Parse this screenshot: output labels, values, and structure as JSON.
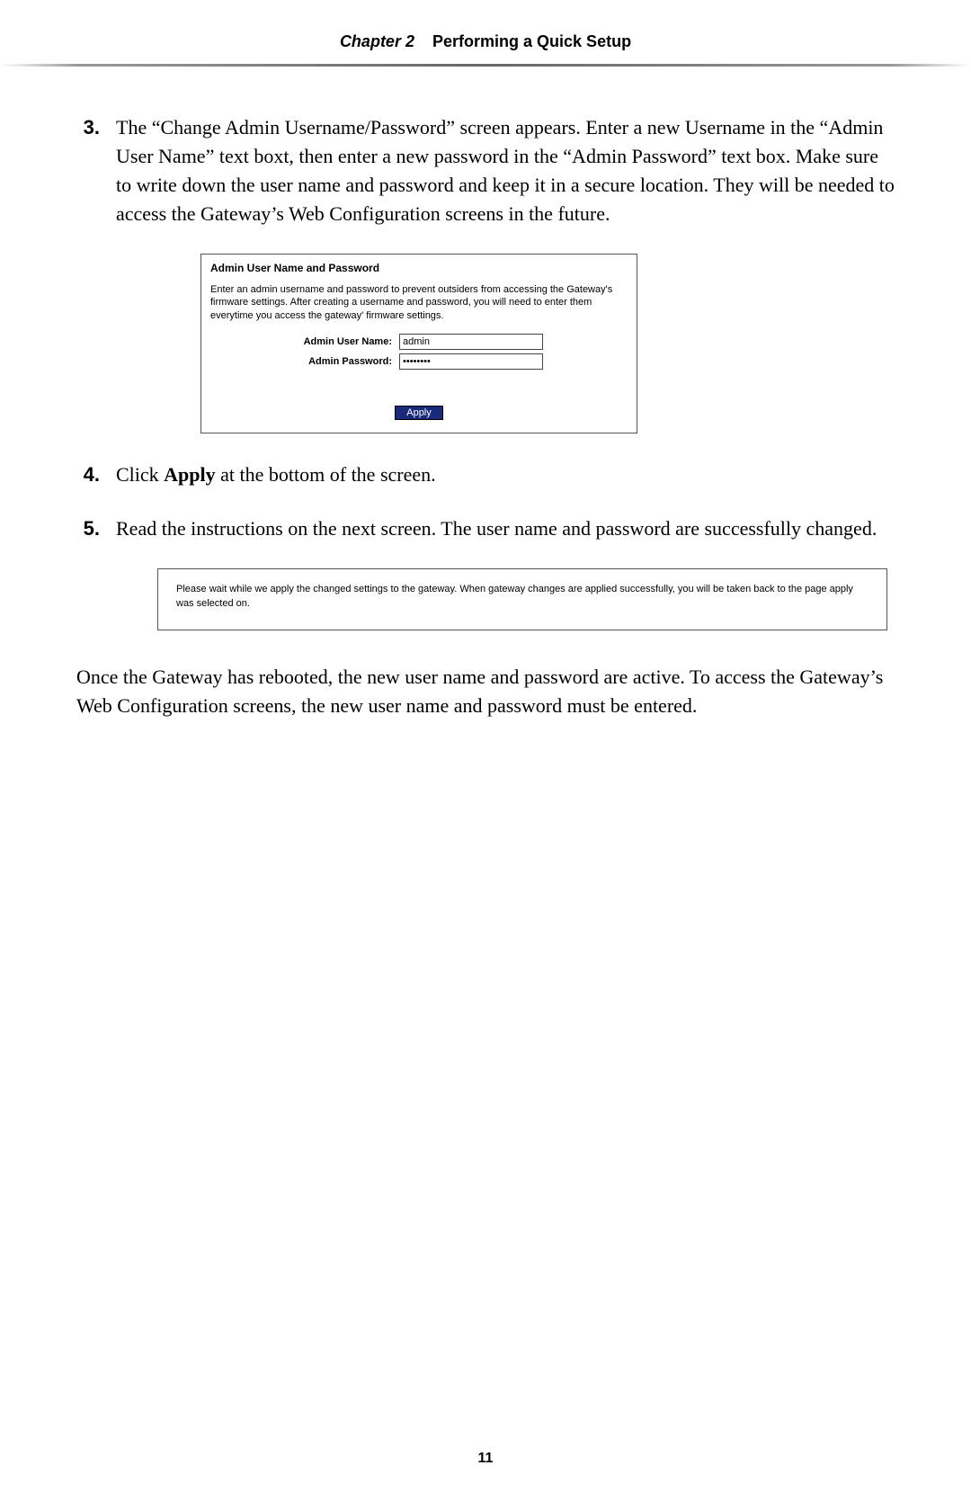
{
  "header": {
    "chapter_prefix": "Chapter 2",
    "chapter_title": "Performing a Quick Setup"
  },
  "steps": {
    "s3": {
      "num": "3.",
      "text": "The “Change Admin Username/Password” screen appears. Enter a new Username in the “Admin User Name” text boxt, then enter a new password in the “Admin Password” text box. Make sure to write down the user name and password and keep it in a secure location. They will be needed to access the Gateway’s Web Configuration screens in the future."
    },
    "s4": {
      "num": "4.",
      "text_pre": "Click ",
      "text_bold": "Apply",
      "text_post": " at the bottom of the screen."
    },
    "s5": {
      "num": "5.",
      "text": "Read the instructions on the next screen. The user name and password are successfully changed."
    }
  },
  "panel1": {
    "title": "Admin User Name and Password",
    "desc": "Enter an admin username and password to prevent outsiders from accessing the Gateway's firmware settings. After creating a username and password, you will need to enter them everytime you access the gateway' firmware settings.",
    "username_label": "Admin User Name:",
    "username_value": "admin",
    "password_label": "Admin Password:",
    "password_value": "••••••••",
    "apply_label": "Apply"
  },
  "panel2": {
    "text": "Please wait while we apply the changed settings to the gateway. When gateway changes are applied successfully, you will be taken back to the page apply was selected on."
  },
  "closing": "Once the Gateway has rebooted, the new user name and password are active. To access the Gateway’s Web Configuration screens, the new user name and password must be entered.",
  "page_number": "11"
}
